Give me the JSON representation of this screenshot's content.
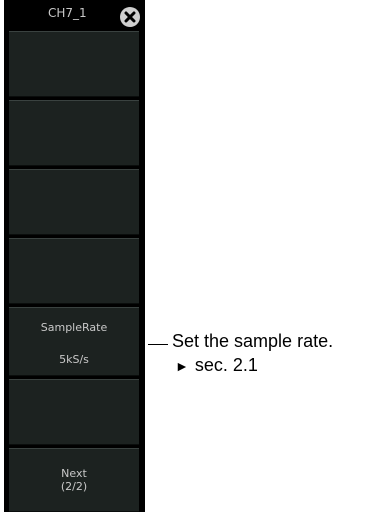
{
  "header": {
    "title": "CH7_1",
    "close_icon": "close-circle-icon"
  },
  "menu": {
    "sample_rate_label": "SampleRate",
    "sample_rate_value": "5kS/s",
    "next_label": "Next",
    "next_page": "(2/2)"
  },
  "annotation": {
    "text": "Set the sample rate.",
    "ref_marker": "►",
    "ref_text": "sec. 2.1"
  },
  "colors": {
    "panel_background": "#000000",
    "button_background": "#1c2220",
    "button_text": "#c8c8c8"
  }
}
